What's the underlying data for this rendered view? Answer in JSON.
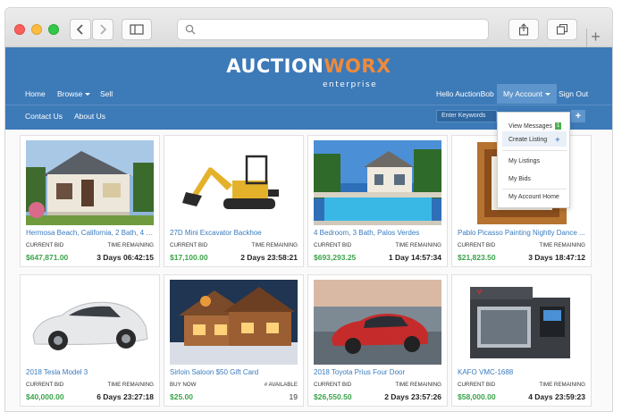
{
  "browser": {
    "buttons": [
      "back",
      "forward",
      "sidebar",
      "share",
      "tabs",
      "new-tab"
    ],
    "new_tab_glyph": "+"
  },
  "site": {
    "logo": {
      "part1": "AUCTION",
      "part2": "WORX",
      "sub": "enterprise"
    },
    "nav_left": [
      {
        "label": "Home"
      },
      {
        "label": "Browse"
      },
      {
        "label": "Sell"
      }
    ],
    "greeting": "Hello AuctionBob",
    "account_menu": "My Account",
    "sign_out": "Sign Out",
    "nav_secondary": [
      {
        "label": "Contact Us"
      },
      {
        "label": "About Us"
      }
    ],
    "search_placeholder": "Enter Keywords",
    "search_plus": "+"
  },
  "dropdown": {
    "items": [
      {
        "label": "View Messages",
        "badge": "1"
      },
      {
        "label": "Create Listing",
        "plus": "+"
      },
      {
        "label": "My Listings"
      },
      {
        "label": "My Bids"
      },
      {
        "label": "My Account Home"
      }
    ]
  },
  "colors": {
    "header_blue": "#3d7ab8",
    "logo_accent": "#f08a3a",
    "title_link": "#3a7bbf",
    "price_green": "#3aa34a"
  },
  "listings": [
    {
      "title": "Hermosa Beach, California, 2 Bath, 4 B...",
      "label_left": "CURRENT BID",
      "label_right": "TIME REMAINING",
      "price": "$647,871.00",
      "time": "3 Days 06:42:15",
      "image": "house"
    },
    {
      "title": "27D Mini Excavator Backhoe",
      "label_left": "CURRENT BID",
      "label_right": "TIME REMAINING",
      "price": "$17,100.00",
      "time": "2 Days 23:58:21",
      "image": "excavator"
    },
    {
      "title": "4 Bedroom, 3 Bath, Palos Verdes",
      "label_left": "CURRENT BID",
      "label_right": "TIME REMAINING",
      "price": "$693,293.25",
      "time": "1 Day 14:57:34",
      "image": "pool-house"
    },
    {
      "title": "Pablo Picasso Painting Nightly Dance ...",
      "label_left": "CURRENT BID",
      "label_right": "TIME REMAINING",
      "price": "$21,823.50",
      "time": "3 Days 18:47:12",
      "image": "frame"
    },
    {
      "title": "2018 Tesla Model 3",
      "label_left": "CURRENT BID",
      "label_right": "TIME REMAINING",
      "price": "$40,000.00",
      "time": "6 Days 23:27:18",
      "image": "tesla"
    },
    {
      "title": "Sirloin Saloon $50 Gift Card",
      "label_left": "BUY NOW",
      "label_right": "# AVAILABLE",
      "price": "$25.00",
      "time": "19",
      "image": "saloon"
    },
    {
      "title": "2018 Toyota Prius Four Door",
      "label_left": "CURRENT BID",
      "label_right": "TIME REMAINING",
      "price": "$26,550.50",
      "time": "2 Days 23:57:26",
      "image": "prius"
    },
    {
      "title": "KAFO VMC-1688",
      "label_left": "CURRENT BID",
      "label_right": "TIME REMAINING",
      "price": "$58,000.00",
      "time": "4 Days 23:59:23",
      "image": "cnc-machine"
    }
  ]
}
